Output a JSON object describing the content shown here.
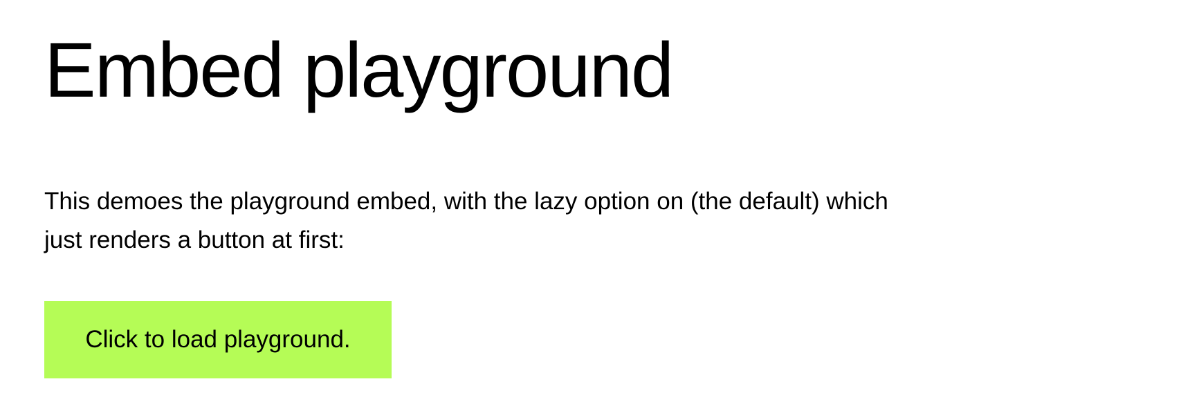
{
  "page": {
    "title": "Embed playground",
    "intro_line1": "This demoes the playground embed, with the lazy option on (the default) which",
    "intro_line2": "just renders a button at first:"
  },
  "embed": {
    "load_button_label": "Click to load playground.",
    "button_color": "#b5fc56"
  }
}
